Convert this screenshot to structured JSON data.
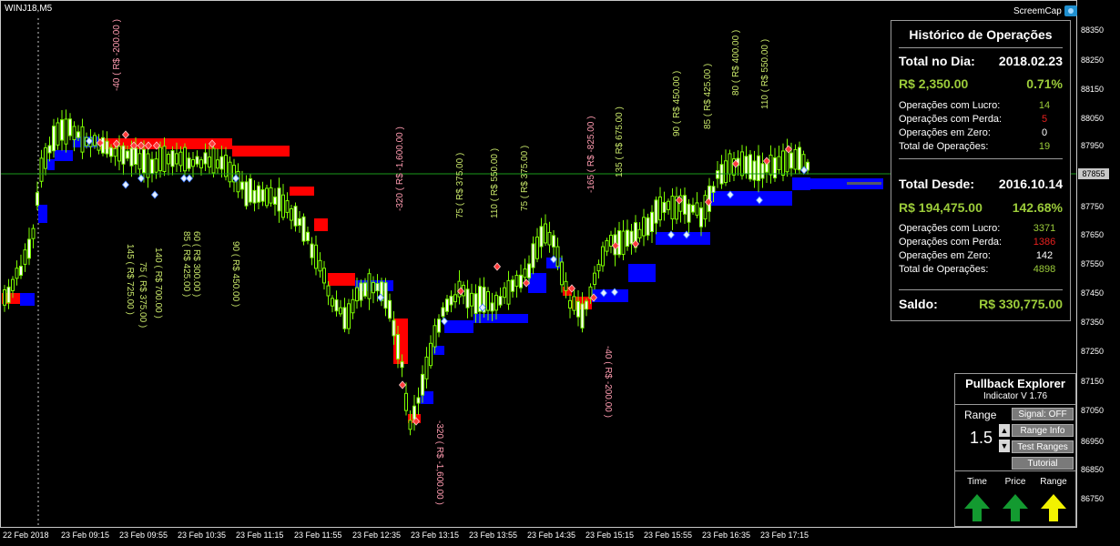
{
  "symbol": "WINJ18,M5",
  "screemcap": "ScreemCap",
  "colors": {
    "bull": "#7cfc00",
    "bear": "#7cfc00",
    "accent_green": "#9ccc3a",
    "accent_red": "#e8201e",
    "band_up": "#0000ff",
    "band_down": "#ff0000",
    "price_line": "#1a9a1a"
  },
  "historico": {
    "title": "Histórico de Operações",
    "dia": {
      "label": "Total no Dia:",
      "date": "2018.02.23",
      "amount": "R$ 2,350.00",
      "percent": "0.71%",
      "stats": [
        {
          "label": "Operações com Lucro:",
          "value": "14",
          "color": "green"
        },
        {
          "label": "Operações com Perda:",
          "value": "5",
          "color": "red"
        },
        {
          "label": "Operações em Zero:",
          "value": "0",
          "color": "white"
        },
        {
          "label": "Total de Operações:",
          "value": "19",
          "color": "green"
        }
      ]
    },
    "desde": {
      "label": "Total Desde:",
      "date": "2016.10.14",
      "amount": "R$ 194,475.00",
      "percent": "142.68%",
      "stats": [
        {
          "label": "Operações com Lucro:",
          "value": "3371",
          "color": "green"
        },
        {
          "label": "Operações com Perda:",
          "value": "1386",
          "color": "red"
        },
        {
          "label": "Operações em Zero:",
          "value": "142",
          "color": "white"
        },
        {
          "label": "Total de Operações:",
          "value": "4898",
          "color": "green"
        }
      ]
    },
    "saldo_label": "Saldo:",
    "saldo_value": "R$ 330,775.00"
  },
  "pullback": {
    "title": "Pullback Explorer",
    "version": "Indicator V 1.76",
    "range_label": "Range",
    "range_value": "1.5",
    "buttons": [
      "Signal: OFF",
      "Range Info",
      "Test Ranges",
      "Tutorial"
    ],
    "indicators": [
      {
        "label": "Time",
        "icon": "arrow-up-green-icon"
      },
      {
        "label": "Price",
        "icon": "arrow-up-green-icon"
      },
      {
        "label": "Range",
        "icon": "arrow-up-yellow-icon"
      }
    ]
  },
  "yaxis": [
    "88350",
    "88250",
    "88150",
    "88050",
    "87950",
    "87855",
    "87750",
    "87650",
    "87550",
    "87450",
    "87350",
    "87250",
    "87150",
    "87050",
    "86950",
    "86850",
    "86750"
  ],
  "price_tag": "87855",
  "xaxis": [
    "22 Feb 2018",
    "23 Feb 09:15",
    "23 Feb 09:55",
    "23 Feb 10:35",
    "23 Feb 11:15",
    "23 Feb 11:55",
    "23 Feb 12:35",
    "23 Feb 13:15",
    "23 Feb 13:55",
    "23 Feb 14:35",
    "23 Feb 15:15",
    "23 Feb 15:55",
    "23 Feb 16:35",
    "23 Feb 17:15"
  ],
  "trade_labels": [
    {
      "text": "-40 ( R$ -200.00 )",
      "color": "#ff9bb0"
    },
    {
      "text": "145 ( R$ 725.00 )",
      "color": "#c8e66a"
    },
    {
      "text": "75 ( R$ 375.00 )",
      "color": "#c8e66a"
    },
    {
      "text": "140 ( R$ 700.00 )",
      "color": "#c8e66a"
    },
    {
      "text": "85 ( R$ 425.00 )",
      "color": "#c8e66a"
    },
    {
      "text": "60 ( R$ 300.00 )",
      "color": "#c8e66a"
    },
    {
      "text": "90 ( R$ 450.00 )",
      "color": "#c8e66a"
    },
    {
      "text": "-320 ( R$ -1,600.00 )",
      "color": "#ff9bb0"
    },
    {
      "text": "-320 ( R$ -1,600.00 )",
      "color": "#ff9bb0"
    },
    {
      "text": "75 ( R$ 375.00 )",
      "color": "#c8e66a"
    },
    {
      "text": "110 ( R$ 550.00 )",
      "color": "#c8e66a"
    },
    {
      "text": "75 ( R$ 375.00 )",
      "color": "#c8e66a"
    },
    {
      "text": "-165 ( R$ -825.00 )",
      "color": "#ff9bb0"
    },
    {
      "text": "135 ( R$ 675.00 )",
      "color": "#c8e66a"
    },
    {
      "text": "-40 ( R$ -200.00 )",
      "color": "#ff9bb0"
    },
    {
      "text": "90 ( R$ 450.00 )",
      "color": "#c8e66a"
    },
    {
      "text": "85 ( R$ 425.00 )",
      "color": "#c8e66a"
    },
    {
      "text": "80 ( R$ 400.00 )",
      "color": "#c8e66a"
    },
    {
      "text": "110 ( R$ 550.00 )",
      "color": "#c8e66a"
    }
  ]
}
